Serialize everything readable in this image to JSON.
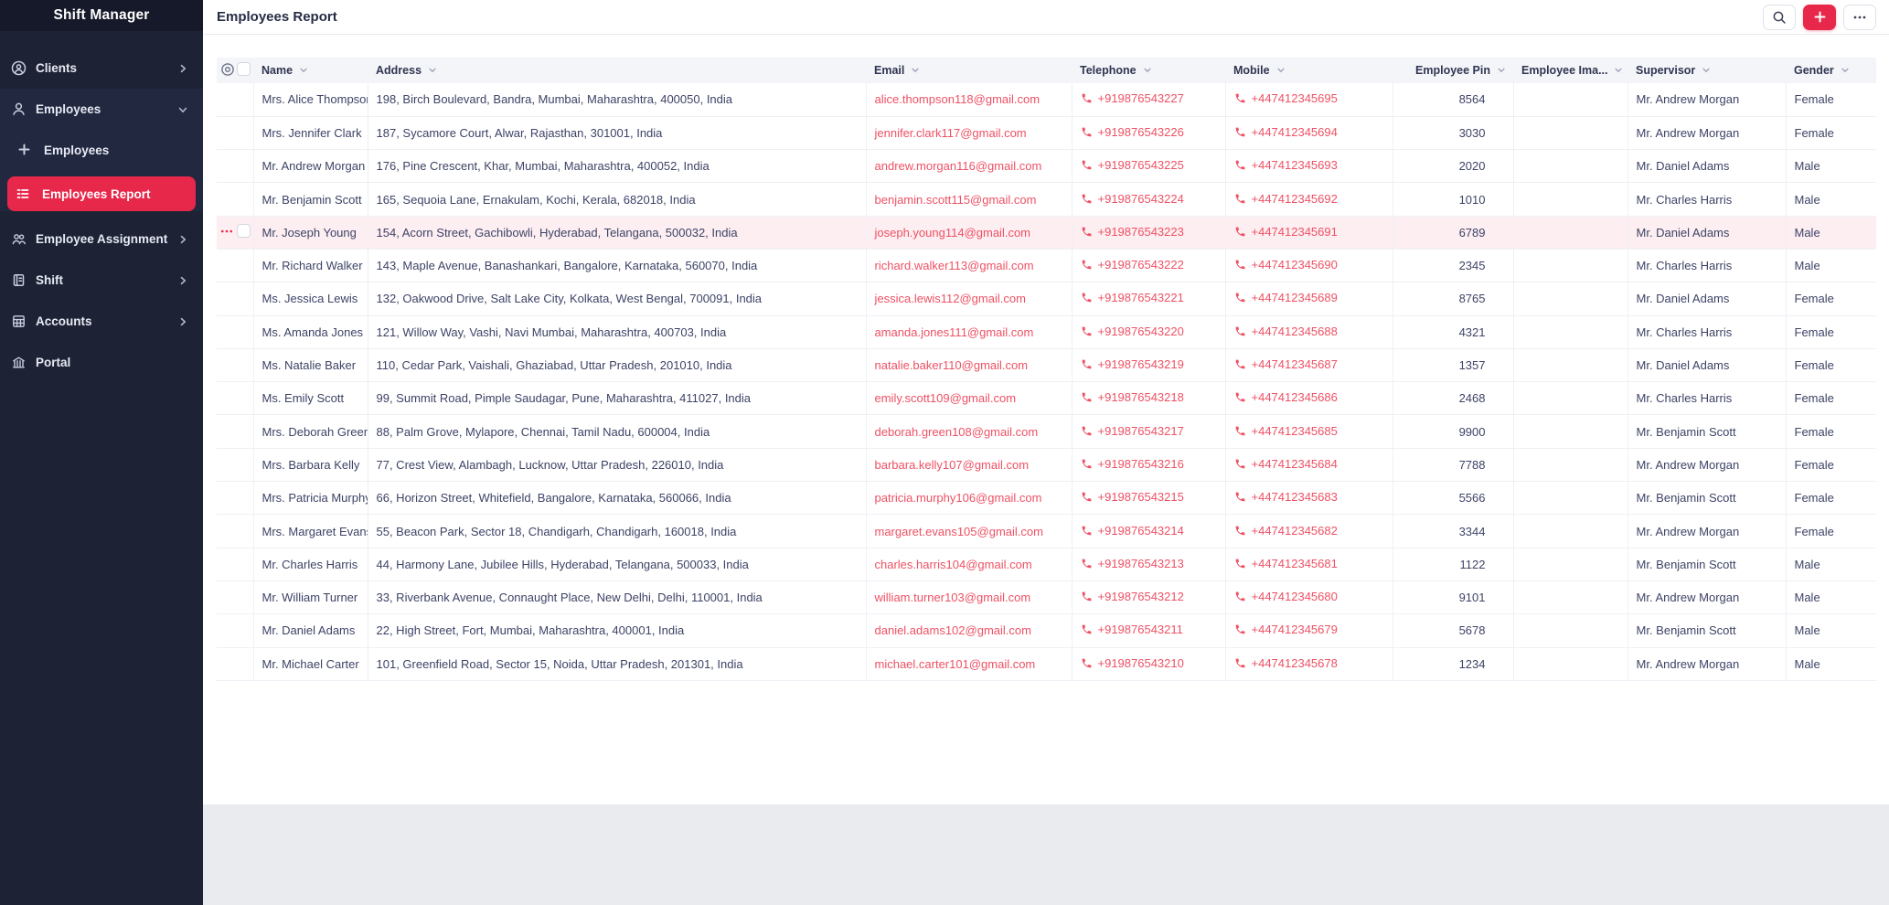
{
  "app_title": "Shift Manager",
  "sidebar": {
    "clients": "Clients",
    "employees_group": "Employees",
    "employees_sub": "Employees",
    "employees_report": "Employees Report",
    "employee_assignment": "Employee Assignment",
    "shift": "Shift",
    "accounts": "Accounts",
    "portal": "Portal"
  },
  "header": {
    "title": "Employees Report"
  },
  "toolbar": {
    "icons": [
      "search-icon",
      "plus-icon",
      "ellipsis-icon"
    ]
  },
  "colors": {
    "accent_red": "#e8284b",
    "link_red": "#ee5164",
    "row_highlight": "#fdeef1",
    "sidebar_bg": "#1d2234",
    "sidebar_group_bg": "#222840",
    "header_band_bg": "#f4f5f8"
  },
  "table": {
    "highlighted_row_index": 4,
    "columns": [
      {
        "key": "name",
        "label": "Name"
      },
      {
        "key": "address",
        "label": "Address"
      },
      {
        "key": "email",
        "label": "Email"
      },
      {
        "key": "telephone",
        "label": "Telephone"
      },
      {
        "key": "mobile",
        "label": "Mobile"
      },
      {
        "key": "pin",
        "label": "Employee Pin"
      },
      {
        "key": "image",
        "label": "Employee Ima..."
      },
      {
        "key": "supervisor",
        "label": "Supervisor"
      },
      {
        "key": "gender",
        "label": "Gender"
      }
    ],
    "rows": [
      {
        "name": "Mrs. Alice Thompson",
        "address": "198, Birch Boulevard, Bandra, Mumbai, Maharashtra, 400050, India",
        "email": "alice.thompson118@gmail.com",
        "telephone": "+919876543227",
        "mobile": "+447412345695",
        "pin": "8564",
        "supervisor": "Mr. Andrew Morgan",
        "gender": "Female"
      },
      {
        "name": "Mrs. Jennifer Clark",
        "address": "187, Sycamore Court, Alwar, Rajasthan, 301001, India",
        "email": "jennifer.clark117@gmail.com",
        "telephone": "+919876543226",
        "mobile": "+447412345694",
        "pin": "3030",
        "supervisor": "Mr. Andrew Morgan",
        "gender": "Female"
      },
      {
        "name": "Mr. Andrew Morgan",
        "address": "176, Pine Crescent, Khar, Mumbai, Maharashtra, 400052, India",
        "email": "andrew.morgan116@gmail.com",
        "telephone": "+919876543225",
        "mobile": "+447412345693",
        "pin": "2020",
        "supervisor": "Mr. Daniel Adams",
        "gender": "Male"
      },
      {
        "name": "Mr. Benjamin Scott",
        "address": "165, Sequoia Lane, Ernakulam, Kochi, Kerala, 682018, India",
        "email": "benjamin.scott115@gmail.com",
        "telephone": "+919876543224",
        "mobile": "+447412345692",
        "pin": "1010",
        "supervisor": "Mr. Charles Harris",
        "gender": "Male"
      },
      {
        "name": "Mr. Joseph Young",
        "address": "154, Acorn Street, Gachibowli, Hyderabad, Telangana, 500032, India",
        "email": "joseph.young114@gmail.com",
        "telephone": "+919876543223",
        "mobile": "+447412345691",
        "pin": "6789",
        "supervisor": "Mr. Daniel Adams",
        "gender": "Male"
      },
      {
        "name": "Mr. Richard Walker",
        "address": "143, Maple Avenue, Banashankari, Bangalore, Karnataka, 560070, India",
        "email": "richard.walker113@gmail.com",
        "telephone": "+919876543222",
        "mobile": "+447412345690",
        "pin": "2345",
        "supervisor": "Mr. Charles Harris",
        "gender": "Male"
      },
      {
        "name": "Ms. Jessica Lewis",
        "address": "132, Oakwood Drive, Salt Lake City, Kolkata, West Bengal, 700091, India",
        "email": "jessica.lewis112@gmail.com",
        "telephone": "+919876543221",
        "mobile": "+447412345689",
        "pin": "8765",
        "supervisor": "Mr. Daniel Adams",
        "gender": "Female"
      },
      {
        "name": "Ms. Amanda Jones",
        "address": "121, Willow Way, Vashi, Navi Mumbai, Maharashtra, 400703, India",
        "email": "amanda.jones111@gmail.com",
        "telephone": "+919876543220",
        "mobile": "+447412345688",
        "pin": "4321",
        "supervisor": "Mr. Charles Harris",
        "gender": "Female"
      },
      {
        "name": "Ms. Natalie Baker",
        "address": "110, Cedar Park, Vaishali, Ghaziabad, Uttar Pradesh, 201010, India",
        "email": "natalie.baker110@gmail.com",
        "telephone": "+919876543219",
        "mobile": "+447412345687",
        "pin": "1357",
        "supervisor": "Mr. Daniel Adams",
        "gender": "Female"
      },
      {
        "name": "Ms. Emily Scott",
        "address": "99, Summit Road, Pimple Saudagar, Pune, Maharashtra, 411027, India",
        "email": "emily.scott109@gmail.com",
        "telephone": "+919876543218",
        "mobile": "+447412345686",
        "pin": "2468",
        "supervisor": "Mr. Charles Harris",
        "gender": "Female"
      },
      {
        "name": "Mrs. Deborah Green",
        "address": "88, Palm Grove, Mylapore, Chennai, Tamil Nadu, 600004, India",
        "email": "deborah.green108@gmail.com",
        "telephone": "+919876543217",
        "mobile": "+447412345685",
        "pin": "9900",
        "supervisor": "Mr. Benjamin Scott",
        "gender": "Female"
      },
      {
        "name": "Mrs. Barbara Kelly",
        "address": "77, Crest View, Alambagh, Lucknow, Uttar Pradesh, 226010, India",
        "email": "barbara.kelly107@gmail.com",
        "telephone": "+919876543216",
        "mobile": "+447412345684",
        "pin": "7788",
        "supervisor": "Mr. Andrew Morgan",
        "gender": "Female"
      },
      {
        "name": "Mrs. Patricia Murphy",
        "address": "66, Horizon Street, Whitefield, Bangalore, Karnataka, 560066, India",
        "email": "patricia.murphy106@gmail.com",
        "telephone": "+919876543215",
        "mobile": "+447412345683",
        "pin": "5566",
        "supervisor": "Mr. Benjamin Scott",
        "gender": "Female"
      },
      {
        "name": "Mrs. Margaret Evans",
        "address": "55, Beacon Park, Sector 18, Chandigarh, Chandigarh, 160018, India",
        "email": "margaret.evans105@gmail.com",
        "telephone": "+919876543214",
        "mobile": "+447412345682",
        "pin": "3344",
        "supervisor": "Mr. Andrew Morgan",
        "gender": "Female"
      },
      {
        "name": "Mr. Charles Harris",
        "address": "44, Harmony Lane, Jubilee Hills, Hyderabad, Telangana, 500033, India",
        "email": "charles.harris104@gmail.com",
        "telephone": "+919876543213",
        "mobile": "+447412345681",
        "pin": "1122",
        "supervisor": "Mr. Benjamin Scott",
        "gender": "Male"
      },
      {
        "name": "Mr. William Turner",
        "address": "33, Riverbank Avenue, Connaught Place, New Delhi, Delhi, 110001, India",
        "email": "william.turner103@gmail.com",
        "telephone": "+919876543212",
        "mobile": "+447412345680",
        "pin": "9101",
        "supervisor": "Mr. Andrew Morgan",
        "gender": "Male"
      },
      {
        "name": "Mr. Daniel Adams",
        "address": "22, High Street, Fort, Mumbai, Maharashtra, 400001, India",
        "email": "daniel.adams102@gmail.com",
        "telephone": "+919876543211",
        "mobile": "+447412345679",
        "pin": "5678",
        "supervisor": "Mr. Benjamin Scott",
        "gender": "Male"
      },
      {
        "name": "Mr. Michael Carter",
        "address": "101, Greenfield Road, Sector 15, Noida, Uttar Pradesh, 201301, India",
        "email": "michael.carter101@gmail.com",
        "telephone": "+919876543210",
        "mobile": "+447412345678",
        "pin": "1234",
        "supervisor": "Mr. Andrew Morgan",
        "gender": "Male"
      }
    ]
  }
}
